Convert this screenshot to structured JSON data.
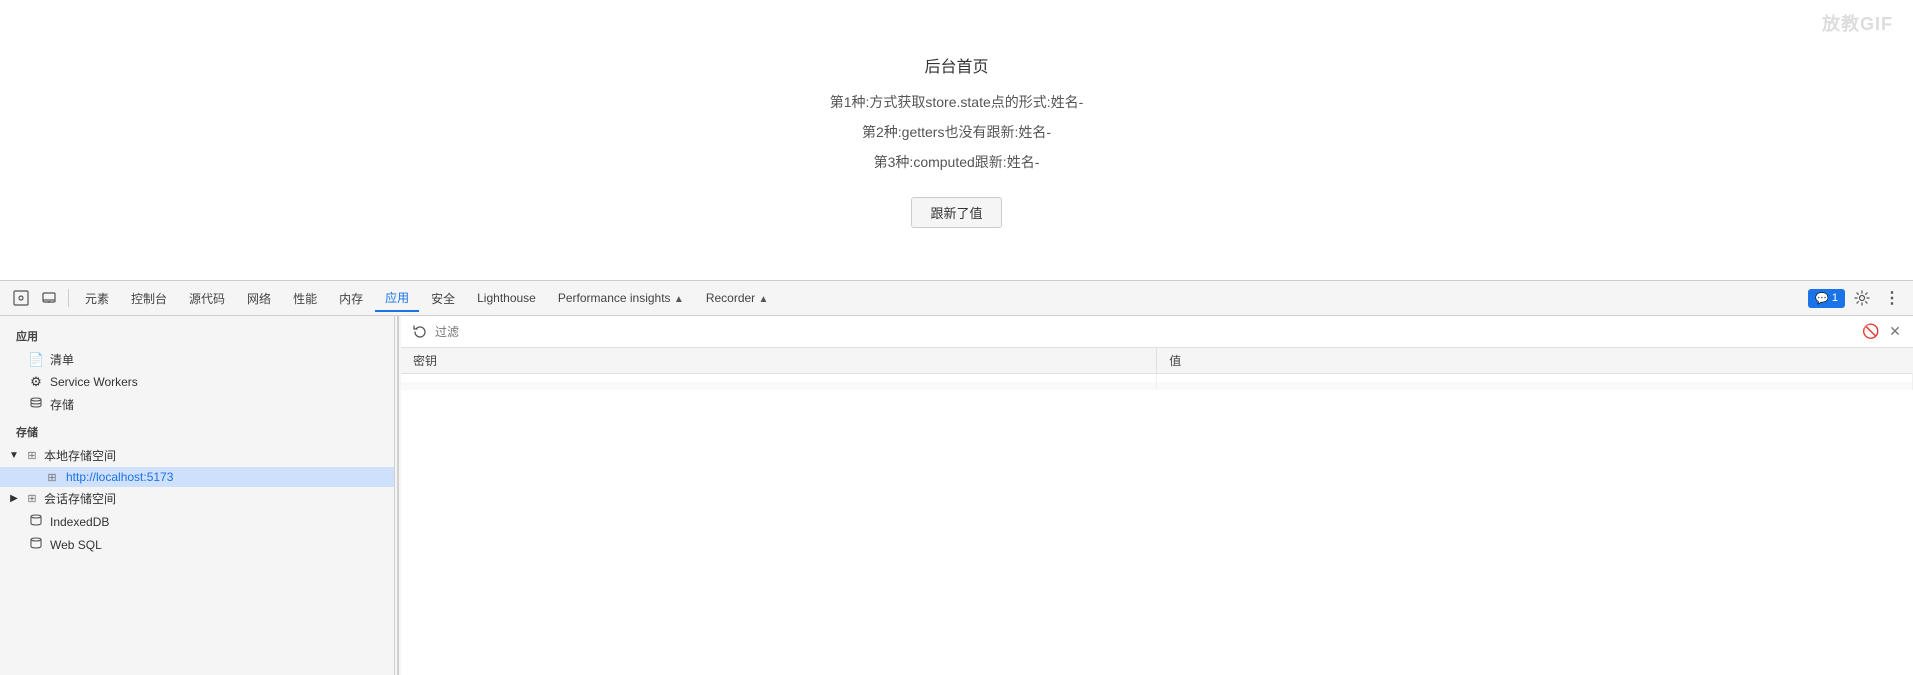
{
  "watermark": {
    "text": "放教GIF"
  },
  "main": {
    "title": "后台首页",
    "line1": "第1种:方式获取store.state点的形式:姓名-",
    "line2": "第2种:getters也没有跟新:姓名-",
    "line3": "第3种:computed跟新:姓名-",
    "button_label": "跟新了值"
  },
  "devtools": {
    "toolbar": {
      "inspect_icon": "⬡",
      "device_icon": "▭",
      "tabs": [
        {
          "id": "elements",
          "label": "元素",
          "active": false
        },
        {
          "id": "console",
          "label": "控制台",
          "active": false
        },
        {
          "id": "sources",
          "label": "源代码",
          "active": false
        },
        {
          "id": "network",
          "label": "网络",
          "active": false
        },
        {
          "id": "performance",
          "label": "性能",
          "active": false
        },
        {
          "id": "memory",
          "label": "内存",
          "active": false
        },
        {
          "id": "application",
          "label": "应用",
          "active": true
        },
        {
          "id": "security",
          "label": "安全",
          "active": false
        },
        {
          "id": "lighthouse",
          "label": "Lighthouse",
          "active": false
        },
        {
          "id": "performance-insights",
          "label": "Performance insights",
          "active": false,
          "has_arrow": true
        },
        {
          "id": "recorder",
          "label": "Recorder",
          "active": false,
          "has_arrow": true
        }
      ],
      "badge_count": "1",
      "settings_icon": "⚙",
      "more_icon": "⋮"
    },
    "sidebar": {
      "app_section_label": "应用",
      "app_items": [
        {
          "id": "manifest",
          "icon": "📄",
          "label": "清单"
        },
        {
          "id": "service-workers",
          "icon": "⚙",
          "label": "Service Workers"
        },
        {
          "id": "storage",
          "icon": "💾",
          "label": "存储"
        }
      ],
      "storage_section_label": "存储",
      "local_storage_group": {
        "label": "本地存储空间",
        "icon": "⊞",
        "expanded": true,
        "items": [
          {
            "id": "localhost-5173",
            "icon": "⊞",
            "label": "http://localhost:5173",
            "active": true
          }
        ]
      },
      "session_storage_group": {
        "label": "会话存储空间",
        "icon": "⊞",
        "expanded": false
      },
      "indexed_db_item": {
        "label": "IndexedDB",
        "icon": "🗄"
      },
      "web_sql_item": {
        "label": "Web SQL",
        "icon": "🗄"
      }
    },
    "main_panel": {
      "filter_placeholder": "过滤",
      "table": {
        "columns": [
          {
            "id": "key",
            "label": "密钥"
          },
          {
            "id": "value",
            "label": "值"
          }
        ],
        "rows": []
      }
    }
  }
}
